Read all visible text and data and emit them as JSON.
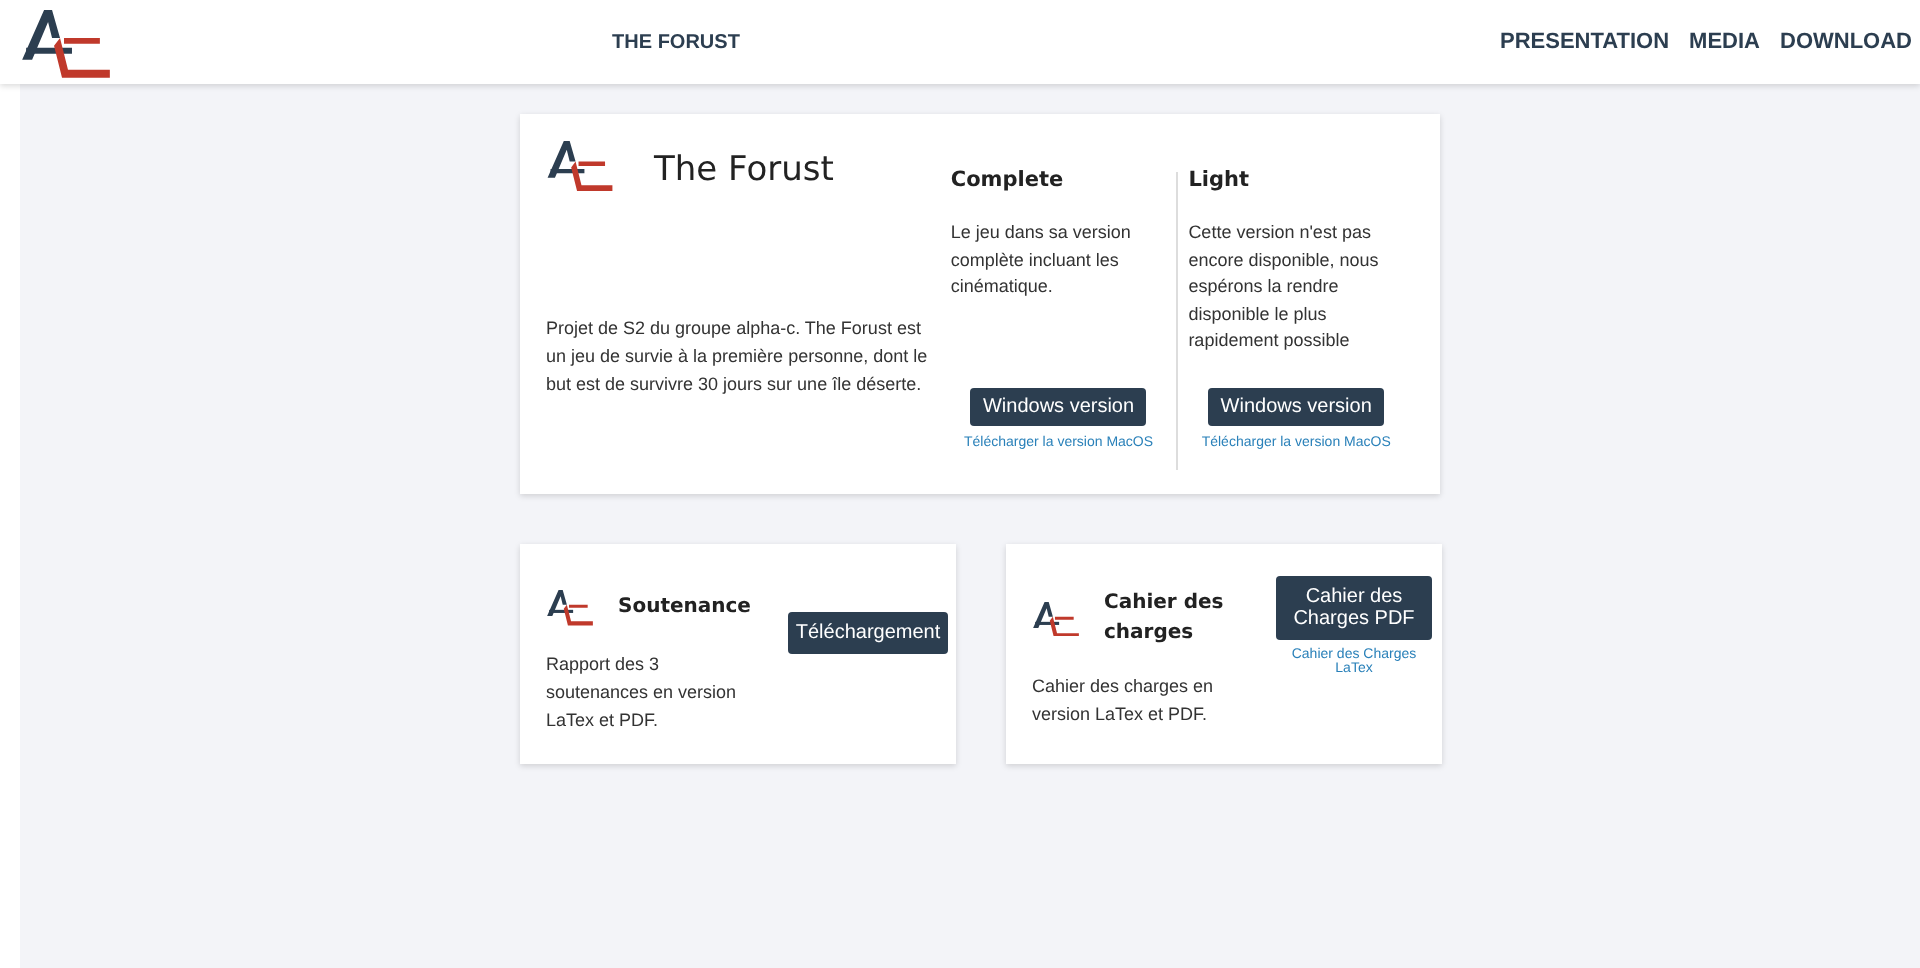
{
  "header": {
    "title": "THE FORUST",
    "nav": [
      {
        "label": "PRESENTATION"
      },
      {
        "label": "MEDIA"
      },
      {
        "label": "DOWNLOAD"
      }
    ]
  },
  "main_card": {
    "title": "The Forust",
    "description": "Projet de S2 du groupe alpha-c. The Forust est un jeu de survie à la première personne, dont le but est de survivre 30 jours sur une île déserte.",
    "versions": [
      {
        "title": "Complete",
        "text": "Le jeu dans sa version complète incluant les cinématique.",
        "button": "Windows version",
        "link": "Télécharger la version MacOS"
      },
      {
        "title": "Light",
        "text": "Cette version n'est pas encore disponible, nous espérons la rendre disponible le plus rapidement possible",
        "button": "Windows version",
        "link": "Télécharger la version MacOS"
      }
    ]
  },
  "cards": [
    {
      "title": "Soutenance",
      "text": "Rapport des 3 soutenances en version LaTex et PDF.",
      "button": "Téléchargement"
    },
    {
      "title": "Cahier des charges",
      "text": "Cahier des charges en version LaTex et PDF.",
      "button": "Cahier des Charges PDF",
      "link": "Cahier des Charges LaTex"
    }
  ]
}
